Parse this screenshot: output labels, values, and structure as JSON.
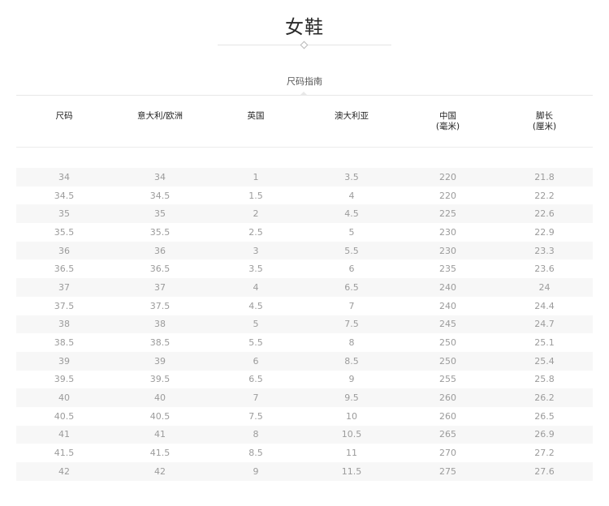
{
  "page": {
    "title": "女鞋",
    "subtitle": "尺码指南"
  },
  "table": {
    "headers": [
      "尺码",
      "意大利/欧洲",
      "英国",
      "澳大利亚",
      "中国\n(毫米)",
      "脚长\n(厘米)"
    ],
    "rows": [
      [
        "34",
        "34",
        "1",
        "3.5",
        "220",
        "21.8"
      ],
      [
        "34.5",
        "34.5",
        "1.5",
        "4",
        "220",
        "22.2"
      ],
      [
        "35",
        "35",
        "2",
        "4.5",
        "225",
        "22.6"
      ],
      [
        "35.5",
        "35.5",
        "2.5",
        "5",
        "230",
        "22.9"
      ],
      [
        "36",
        "36",
        "3",
        "5.5",
        "230",
        "23.3"
      ],
      [
        "36.5",
        "36.5",
        "3.5",
        "6",
        "235",
        "23.6"
      ],
      [
        "37",
        "37",
        "4",
        "6.5",
        "240",
        "24"
      ],
      [
        "37.5",
        "37.5",
        "4.5",
        "7",
        "240",
        "24.4"
      ],
      [
        "38",
        "38",
        "5",
        "7.5",
        "245",
        "24.7"
      ],
      [
        "38.5",
        "38.5",
        "5.5",
        "8",
        "250",
        "25.1"
      ],
      [
        "39",
        "39",
        "6",
        "8.5",
        "250",
        "25.4"
      ],
      [
        "39.5",
        "39.5",
        "6.5",
        "9",
        "255",
        "25.8"
      ],
      [
        "40",
        "40",
        "7",
        "9.5",
        "260",
        "26.2"
      ],
      [
        "40.5",
        "40.5",
        "7.5",
        "10",
        "260",
        "26.5"
      ],
      [
        "41",
        "41",
        "8",
        "10.5",
        "265",
        "26.9"
      ],
      [
        "41.5",
        "41.5",
        "8.5",
        "11",
        "270",
        "27.2"
      ],
      [
        "42",
        "42",
        "9",
        "11.5",
        "275",
        "27.6"
      ]
    ]
  }
}
